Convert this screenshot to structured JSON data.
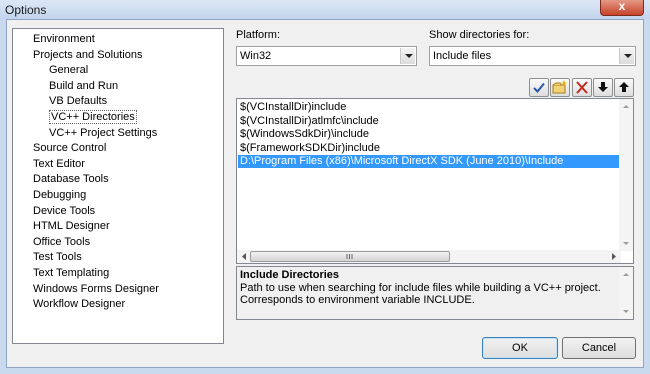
{
  "window": {
    "title": "Options",
    "close_glyph": "x"
  },
  "tree": {
    "items": [
      "Environment",
      "Projects and Solutions",
      "General",
      "Build and Run",
      "VB Defaults",
      "VC++ Directories",
      "VC++ Project Settings",
      "Source Control",
      "Text Editor",
      "Database Tools",
      "Debugging",
      "Device Tools",
      "HTML Designer",
      "Office Tools",
      "Test Tools",
      "Text Templating",
      "Windows Forms Designer",
      "Workflow Designer"
    ],
    "selected": "VC++ Directories"
  },
  "platform": {
    "label": "Platform:",
    "value": "Win32"
  },
  "show_dirs": {
    "label": "Show directories for:",
    "value": "Include files"
  },
  "toolbar": {
    "icons": [
      "checkmark-icon",
      "new-folder-icon",
      "delete-icon",
      "move-down-icon",
      "move-up-icon"
    ]
  },
  "directories": [
    "$(VCInstallDir)include",
    "$(VCInstallDir)atlmfc\\include",
    "$(WindowsSdkDir)\\include",
    "$(FrameworkSDKDir)include",
    "D:\\Program Files (x86)\\Microsoft DirectX SDK (June 2010)\\Include"
  ],
  "selected_directory_index": 4,
  "description": {
    "title": "Include Directories",
    "text": "Path to use when searching for include files while building a VC++ project. Corresponds to environment variable INCLUDE."
  },
  "buttons": {
    "ok": "OK",
    "cancel": "Cancel"
  },
  "colors": {
    "selection": "#3399ff",
    "close_button": "#c8432a"
  }
}
